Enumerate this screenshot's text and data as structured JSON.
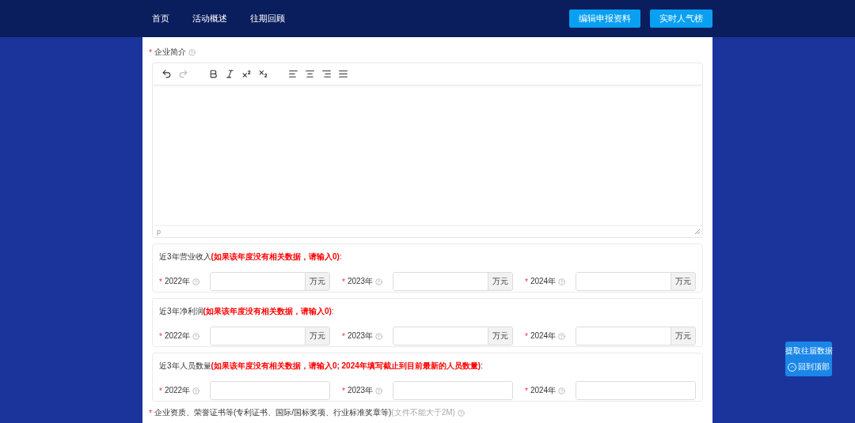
{
  "nav": {
    "items": [
      {
        "label": "首页"
      },
      {
        "label": "活动概述"
      },
      {
        "label": "往期回顾"
      }
    ],
    "buttons": [
      "编辑申报资料",
      "实时人气榜"
    ]
  },
  "intro": {
    "label": "企业简介",
    "required_mark": "*",
    "status": "p"
  },
  "groups": [
    {
      "label": "近3年营业收入",
      "note": "(如果该年度没有相关数据，请输入0)",
      "suffix": ":",
      "fields": [
        {
          "year": "2022年",
          "required_mark": "*",
          "unit": "万元"
        },
        {
          "year": "2023年",
          "required_mark": "*",
          "unit": "万元"
        },
        {
          "year": "2024年",
          "required_mark": "*",
          "unit": "万元"
        }
      ]
    },
    {
      "label": "近3年净利润",
      "note": "(如果该年度没有相关数据，请输入0)",
      "suffix": ":",
      "fields": [
        {
          "year": "2022年",
          "required_mark": "*",
          "unit": "万元"
        },
        {
          "year": "2023年",
          "required_mark": "*",
          "unit": "万元"
        },
        {
          "year": "2024年",
          "required_mark": "*",
          "unit": "万元"
        }
      ]
    },
    {
      "label": "近3年人员数量",
      "note": "(如果该年度没有相关数据，请输入0; 2024年填写截止到目前最新的人员数量)",
      "suffix": ":",
      "fields": [
        {
          "year": "2022年",
          "required_mark": "*"
        },
        {
          "year": "2023年",
          "required_mark": "*"
        },
        {
          "year": "2024年",
          "required_mark": "*"
        }
      ]
    }
  ],
  "next_field": {
    "label": "企业资质、荣誉证书等(专利证书、国际/国标奖项、行业标准奖章等)",
    "hint": "(文件不能大于2M)",
    "required_mark": "*"
  },
  "float_panel": {
    "items": [
      "提取往届数据",
      "回到顶部"
    ]
  }
}
